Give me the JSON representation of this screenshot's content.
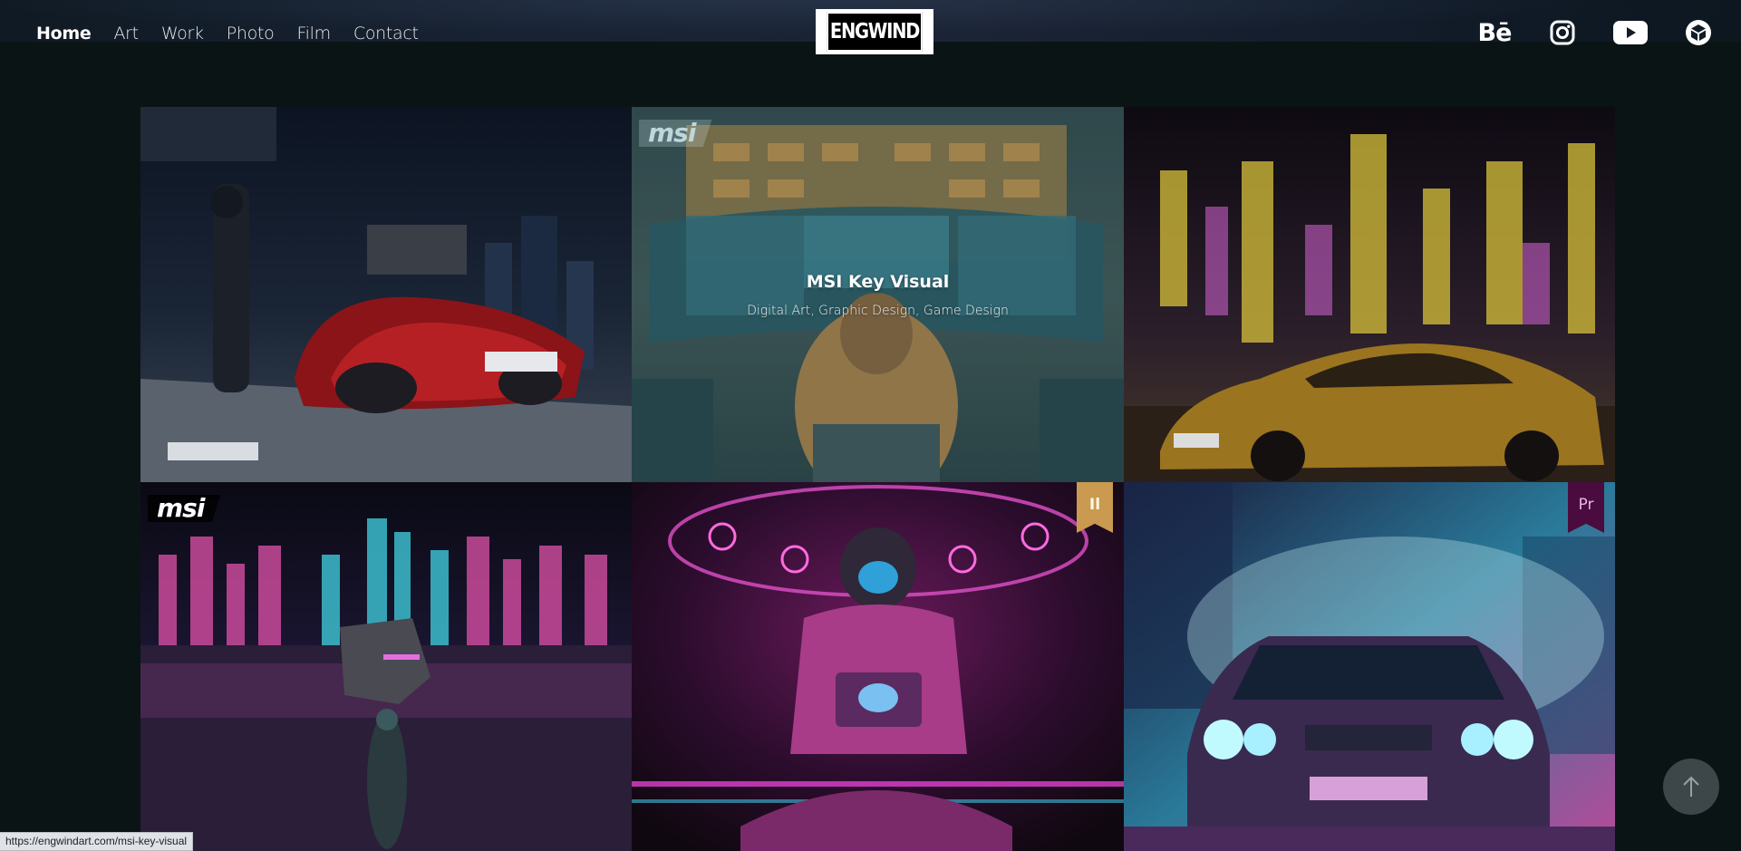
{
  "header": {
    "nav": [
      {
        "label": "Home",
        "active": true
      },
      {
        "label": "Art",
        "active": false
      },
      {
        "label": "Work",
        "active": false
      },
      {
        "label": "Photo",
        "active": false
      },
      {
        "label": "Film",
        "active": false
      },
      {
        "label": "Contact",
        "active": false
      }
    ],
    "logo_text": "ENGWIND",
    "social": [
      "behance-icon",
      "instagram-icon",
      "youtube-icon",
      "sketchfab-icon"
    ],
    "behance_label": "Bē"
  },
  "grid": {
    "tiles": [
      {
        "name": "flying-car-artwork",
        "badge": ""
      },
      {
        "name": "msi-key-visual",
        "badge": "msi",
        "hover_title": "MSI Key Visual",
        "hover_subtitle": "Digital Art, Graphic Design, Game Design"
      },
      {
        "name": "gold-sports-car",
        "badge": ""
      },
      {
        "name": "msi-neon-city",
        "badge": "msi"
      },
      {
        "name": "neon-astronaut",
        "badge": "Il"
      },
      {
        "name": "neon-classic-car",
        "badge": "Pr"
      }
    ]
  },
  "colors": {
    "background": "#0a1414",
    "illustrator_ribbon": "#c99a4f",
    "premiere_ribbon": "#4a0c3e"
  },
  "status_bar": {
    "url": "https://engwindart.com/msi-key-visual"
  },
  "scroll_top": {
    "icon": "arrow-up-icon"
  }
}
